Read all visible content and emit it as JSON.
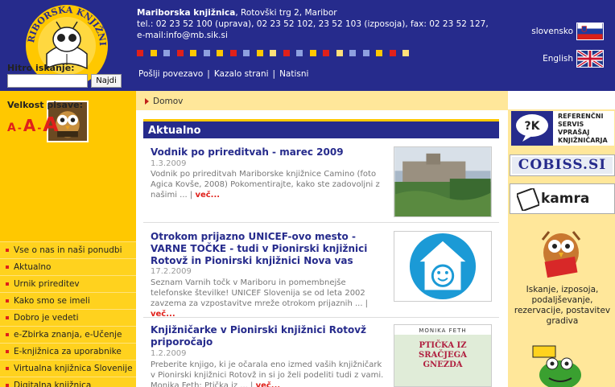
{
  "header": {
    "logo_text": "MARIBORSKA KNJIŽNICA",
    "library_name": "Mariborska knjižnica",
    "address": ", Rotovški trg 2, Maribor",
    "tel_line": "tel.: 02 23 52 100 (uprava), 02 23 52 102, 23 52 103 (izposoja), fax: 02 23 52 127,",
    "email_line": "e-mail:info@mb.sik.si",
    "nav": [
      "Pošlji povezavo",
      "Kazalo strani",
      "Natisni"
    ],
    "lang_sl": "slovensko",
    "lang_en": "English",
    "dot_colors": [
      "#e0201a",
      "#ffc800",
      "#8ea0e0",
      "#e0201a",
      "#ffc800",
      "#8ea0e0",
      "#ffc800",
      "#e0201a",
      "#8ea0e0",
      "#ffc800",
      "#ffe07a",
      "#e0201a",
      "#8ea0e0",
      "#ffc800",
      "#e0201a",
      "#ffe07a",
      "#8ea0e0",
      "#8ea0e0",
      "#ffc800",
      "#e0201a",
      "#ffe07a"
    ]
  },
  "sidebar": {
    "search_label": "Hitro iskanje:",
    "search_value": "",
    "search_button": "Najdi",
    "fontsize_label": "Velkost pisave:",
    "fontsizes": [
      "A",
      "A",
      "A"
    ],
    "fontsize_sep": "-",
    "menu": [
      "Vse o nas in naši ponudbi",
      "Aktualno",
      "Urnik prireditev",
      "Kako smo se imeli",
      "Dobro je vedeti",
      "e-Zbirka znanja, e-Učenje",
      "E-knjižnica za uporabnike",
      "Virtualna knjižnica Slovenije",
      "Digitalna knjižnica"
    ]
  },
  "breadcrumb": "Domov",
  "main": {
    "section_title": "Aktualno",
    "more_label": "več...",
    "news": [
      {
        "title": "Vodnik po prireditvah - marec 2009",
        "date": "1.3.2009",
        "text": "Vodnik po prireditvah Mariborske knjižnice Camino (foto Agica Kovše, 2008) Pokomentirajte, kako ste zadovoljni z našimi ... |"
      },
      {
        "title": "Otrokom prijazno UNICEF-ovo mesto - VARNE TOČKE - tudi v Pionirski knjižnici Rotovž in Pionirski knjižnici Nova vas",
        "date": "17.2.2009",
        "text": "Seznam Varnih točk v Mariboru in pomembnejše telefonske številke! UNICEF Slovenija se od leta 2002 zavzema za vzpostavitve mreže otrokom prijaznih ... |"
      },
      {
        "title": "Knjižničarke v Pionirski knjižnici Rotovž priporočajo",
        "date": "1.2.2009",
        "text": "Preberite knjigo, ki je očarala eno izmed vaših knjižničark v Pionirski knjižnici Rotovž in si jo želi podeliti tudi z vami. Monika Feth: Ptička iz ... |"
      }
    ],
    "book_cover_title": "PTIČKA IZ SRAČJEGA GNEZDA",
    "book_cover_author": "MONIKA FETH"
  },
  "right": {
    "ref_logo": "?K",
    "ref_text": "REFERENČNI SERVIS VPRAŠAJ KNJIŽNIČARJA",
    "cobiss": "COBISS.SI",
    "kamra": "kamra",
    "services_text": "Iskanje, izposoja, podaljševanje, rezervacije, postavitev gradiva"
  }
}
